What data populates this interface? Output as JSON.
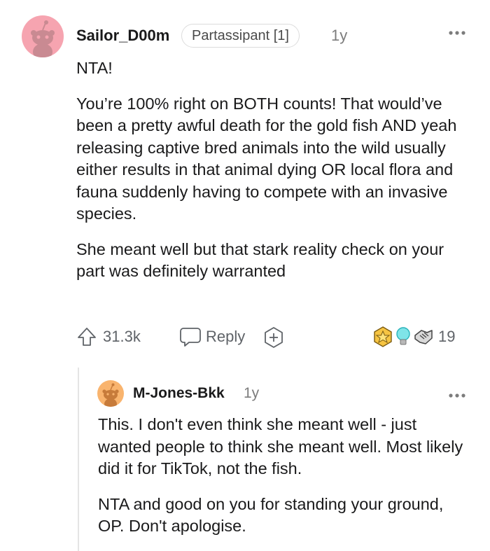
{
  "comment": {
    "username": "Sailor_D00m",
    "flair": "Partassipant [1]",
    "age": "1y",
    "more_icon": "more-horizontal-icon",
    "paragraphs": [
      "NTA!",
      "You’re 100% right on BOTH counts! That would’ve been a pretty awful death for the gold fish AND yeah releasing captive bred animals into the wild usually either results in that animal dying OR local flora and fauna suddenly having to compete with an invasive species.",
      "She meant well but that stark reality check on your part was definitely warranted"
    ],
    "upvotes": "31.3k",
    "reply_label": "Reply",
    "award_count": "19"
  },
  "reply": {
    "username": "M-Jones-Bkk",
    "age": "1y",
    "paragraphs": [
      "This. I don't even think she meant well - just wanted people to think she meant well. Most likely did it for TikTok, not the fish.",
      "NTA and good on you for standing your ground, OP. Don't apologise."
    ]
  },
  "colors": {
    "avatar_pink": "#f6a4b0",
    "avatar_orange": "#f9b46e",
    "text": "#1a1a1b",
    "muted": "#7c7c7c"
  }
}
